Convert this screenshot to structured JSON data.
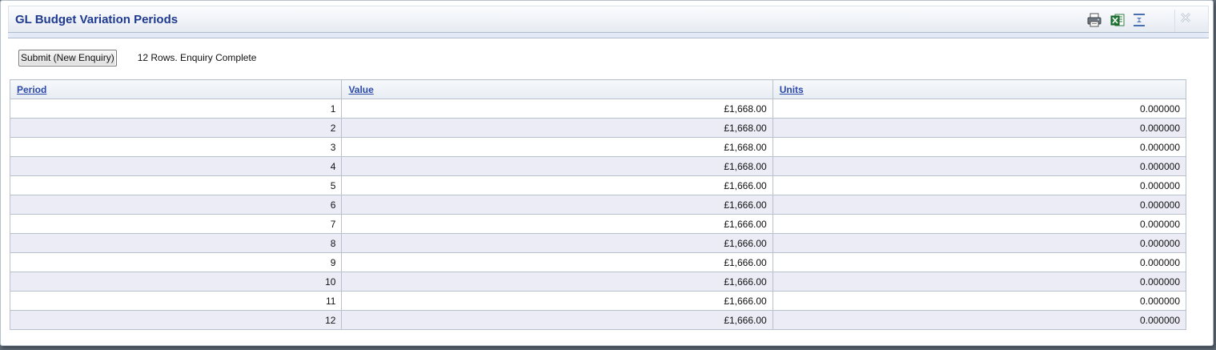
{
  "window": {
    "title": "GL Budget Variation Periods"
  },
  "icons": {
    "print": "print-icon",
    "excel": "excel-export-icon",
    "layout": "column-layout-icon",
    "close": "close-icon"
  },
  "toolbar": {
    "submit_label": "Submit (New Enquiry)",
    "status": "12 Rows. Enquiry Complete"
  },
  "table": {
    "headers": [
      "Period",
      "Value",
      "Units"
    ],
    "rows": [
      [
        "1",
        "£1,668.00",
        "0.000000"
      ],
      [
        "2",
        "£1,668.00",
        "0.000000"
      ],
      [
        "3",
        "£1,668.00",
        "0.000000"
      ],
      [
        "4",
        "£1,668.00",
        "0.000000"
      ],
      [
        "5",
        "£1,666.00",
        "0.000000"
      ],
      [
        "6",
        "£1,666.00",
        "0.000000"
      ],
      [
        "7",
        "£1,666.00",
        "0.000000"
      ],
      [
        "8",
        "£1,666.00",
        "0.000000"
      ],
      [
        "9",
        "£1,666.00",
        "0.000000"
      ],
      [
        "10",
        "£1,666.00",
        "0.000000"
      ],
      [
        "11",
        "£1,666.00",
        "0.000000"
      ],
      [
        "12",
        "£1,666.00",
        "0.000000"
      ]
    ]
  },
  "colors": {
    "title": "#1f3a8f",
    "link": "#2b49a8",
    "row_alt": "#ececf6",
    "border": "#b9c2cc"
  }
}
